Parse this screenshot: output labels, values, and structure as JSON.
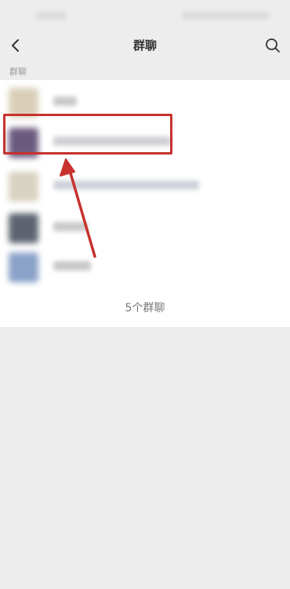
{
  "navbar": {
    "title": "群聊",
    "back_icon": "chevron-left-icon",
    "search_icon": "search-icon"
  },
  "section": {
    "label": "群聊"
  },
  "groups": [
    {
      "avatar_color": "#d9cfb8"
    },
    {
      "avatar_color": "#6b5a7e"
    },
    {
      "avatar_color": "#d8d2c0"
    },
    {
      "avatar_color": "#5d6470"
    },
    {
      "avatar_color": "#8aa1c8"
    }
  ],
  "footer": {
    "count_text": "5个群聊"
  },
  "annotation": {
    "color": "#c7322d"
  }
}
